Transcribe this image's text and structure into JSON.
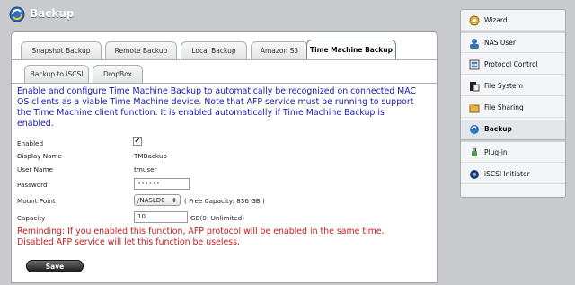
{
  "header": {
    "title": "Backup"
  },
  "tabs_row1": [
    "Snapshot Backup",
    "Remote Backup",
    "Local Backup",
    "Amazon S3",
    "Time Machine Backup"
  ],
  "tabs_row2": [
    "Backup to iSCSI",
    "DropBox"
  ],
  "active_tab": "Time Machine Backup",
  "description": "Enable and configure Time Machine Backup to automatically be recognized on connected MAC OS clients as a viable Time Machine device. Note that AFP service must be running to support the Time Machine client function. It is enabled automatically if Time Machine Backup is enabled.",
  "form": {
    "enabled_label": "Enabled",
    "enabled_checked": "✔",
    "display_name_label": "Display Name",
    "display_name_value": "TMBackup",
    "user_name_label": "User Name",
    "user_name_value": "tmuser",
    "password_label": "Password",
    "password_value": "••••••",
    "mount_point_label": "Mount Point",
    "mount_point_value": "/NASLD0",
    "free_capacity": "( Free Capacity: 836 GB )",
    "capacity_label": "Capacity",
    "capacity_value": "10",
    "capacity_unit": "GB(0: Unlimited)"
  },
  "reminder": "Reminding: If you enabled this function, AFP protocol will be enabled in the same time. Disabled AFP service will let this function be useless.",
  "save_label": "Save",
  "sidebar": {
    "items": [
      {
        "label": "Wizard",
        "icon": "wizard-icon"
      },
      {
        "label": "NAS User",
        "icon": "user-icon"
      },
      {
        "label": "Protocol Control",
        "icon": "protocol-icon"
      },
      {
        "label": "File System",
        "icon": "filesystem-icon"
      },
      {
        "label": "File Sharing",
        "icon": "filesharing-icon"
      },
      {
        "label": "Backup",
        "icon": "backup-icon"
      },
      {
        "label": "Plug-in",
        "icon": "plugin-icon"
      },
      {
        "label": "iSCSI Initiator",
        "icon": "iscsi-icon"
      }
    ],
    "active": "Backup"
  },
  "colors": {
    "description_text": "#1818c6",
    "reminder_text": "#d21c1c",
    "background": "#c8cacd"
  }
}
